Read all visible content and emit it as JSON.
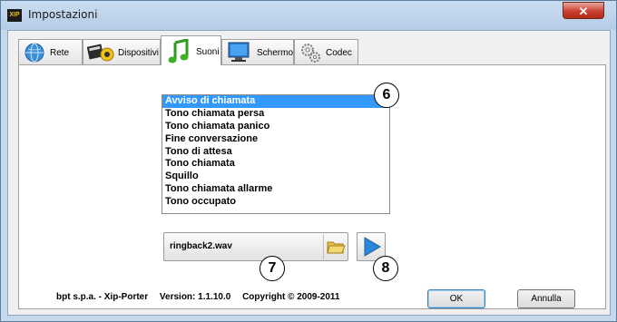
{
  "window": {
    "title": "Impostazioni",
    "close_glyph": "✕",
    "app_icon_text": "XIP"
  },
  "tabs": [
    {
      "label": "Rete",
      "icon": "globe-icon",
      "active": false
    },
    {
      "label": "Dispositivi",
      "icon": "devices-icon",
      "active": false
    },
    {
      "label": "Suoni",
      "icon": "music-note-icon",
      "active": true
    },
    {
      "label": "Schermo",
      "icon": "monitor-icon",
      "active": false
    },
    {
      "label": "Codec",
      "icon": "gears-icon",
      "active": false
    }
  ],
  "sounds_list": {
    "items": [
      "Avviso di chiamata",
      "Tono chiamata persa",
      "Tono chiamata panico",
      "Fine conversazione",
      "Tono di attesa",
      "Tono chiamata",
      "Squillo",
      "Tono chiamata allarme",
      "Tono occupato"
    ],
    "selected_index": 0
  },
  "sound_file": {
    "value": "ringback2.wav",
    "browse_icon": "folder-icon",
    "play_icon": "play-icon"
  },
  "callouts": [
    "6",
    "7",
    "8"
  ],
  "footer": {
    "company": "bpt s.p.a. - Xip-Porter",
    "version": "Version: 1.1.10.0",
    "copyright": "Copyright © 2009-2011"
  },
  "buttons": {
    "ok": "OK",
    "cancel": "Annulla"
  },
  "colors": {
    "selection": "#3399ff",
    "play_accent": "#2a86d8"
  }
}
